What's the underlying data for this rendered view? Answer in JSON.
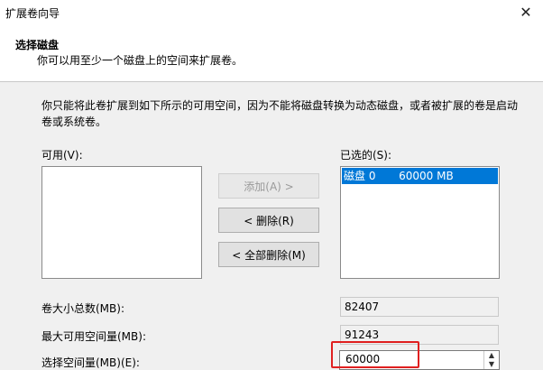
{
  "window": {
    "title": "扩展卷向导"
  },
  "header": {
    "title": "选择磁盘",
    "subtitle": "你可以用至少一个磁盘上的空间来扩展卷。"
  },
  "description": "你只能将此卷扩展到如下所示的可用空间，因为不能将磁盘转换为动态磁盘，或者被扩展的卷是启动卷或系统卷。",
  "available": {
    "label": "可用(V):",
    "items": []
  },
  "selected": {
    "label": "已选的(S):",
    "items": [
      {
        "disk": "磁盘 0",
        "size": "60000 MB"
      }
    ]
  },
  "buttons": {
    "add": "添加(A) >",
    "remove": "< 删除(R)",
    "remove_all": "< 全部删除(M)"
  },
  "fields": {
    "total_label": "卷大小总数(MB):",
    "total_value": "82407",
    "max_label": "最大可用空间量(MB):",
    "max_value": "91243",
    "choose_label": "选择空间量(MB)(E):",
    "choose_value": "60000"
  },
  "icons": {
    "close": "close-icon",
    "spin_up": "spin-up-icon",
    "spin_down": "spin-down-icon"
  },
  "colors": {
    "selection": "#0078d7",
    "highlight": "#e02020"
  }
}
